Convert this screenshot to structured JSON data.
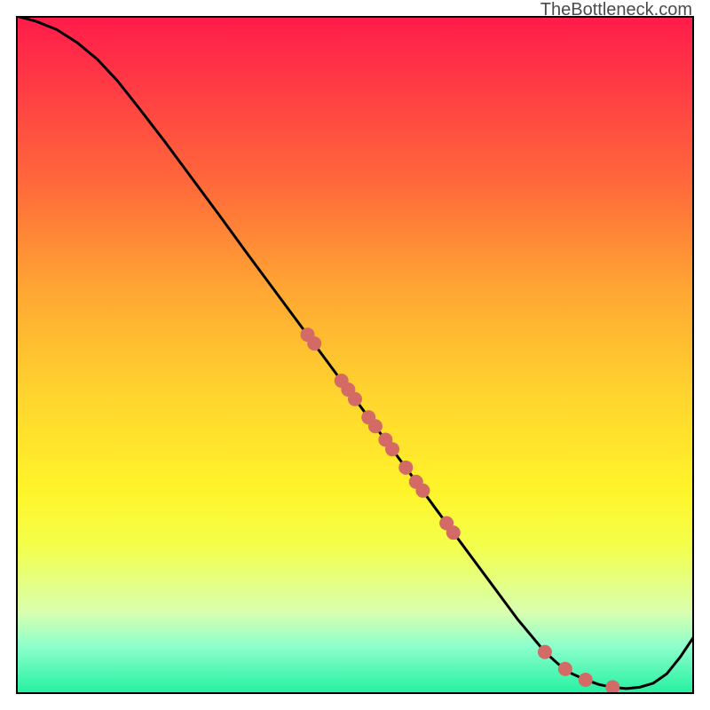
{
  "attribution": "TheBottleneck.com",
  "chart_data": {
    "type": "line",
    "title": "",
    "xlabel": "",
    "ylabel": "",
    "xlim": [
      0,
      1
    ],
    "ylim": [
      0,
      1
    ],
    "grid": false,
    "legend": false,
    "series": [
      {
        "name": "curve",
        "type": "line",
        "color": "#000000",
        "x": [
          0.0,
          0.03,
          0.06,
          0.09,
          0.12,
          0.15,
          0.18,
          0.22,
          0.26,
          0.3,
          0.34,
          0.38,
          0.42,
          0.46,
          0.5,
          0.54,
          0.58,
          0.62,
          0.66,
          0.7,
          0.74,
          0.78,
          0.8,
          0.82,
          0.84,
          0.86,
          0.88,
          0.9,
          0.92,
          0.94,
          0.96,
          0.98,
          1.0
        ],
        "y": [
          1.0,
          0.992,
          0.98,
          0.961,
          0.936,
          0.904,
          0.866,
          0.814,
          0.76,
          0.706,
          0.651,
          0.597,
          0.543,
          0.489,
          0.435,
          0.381,
          0.327,
          0.272,
          0.218,
          0.164,
          0.11,
          0.062,
          0.044,
          0.03,
          0.021,
          0.014,
          0.01,
          0.008,
          0.01,
          0.016,
          0.03,
          0.055,
          0.085
        ]
      },
      {
        "name": "dots",
        "type": "scatter",
        "color": "#d46a66",
        "x": [
          0.43,
          0.44,
          0.48,
          0.49,
          0.5,
          0.52,
          0.53,
          0.545,
          0.555,
          0.575,
          0.59,
          0.6,
          0.635,
          0.645,
          0.78,
          0.81,
          0.84,
          0.88
        ],
        "y": [
          0.53,
          0.517,
          0.462,
          0.449,
          0.435,
          0.408,
          0.395,
          0.375,
          0.361,
          0.334,
          0.313,
          0.3,
          0.252,
          0.238,
          0.062,
          0.037,
          0.021,
          0.01
        ]
      }
    ]
  }
}
